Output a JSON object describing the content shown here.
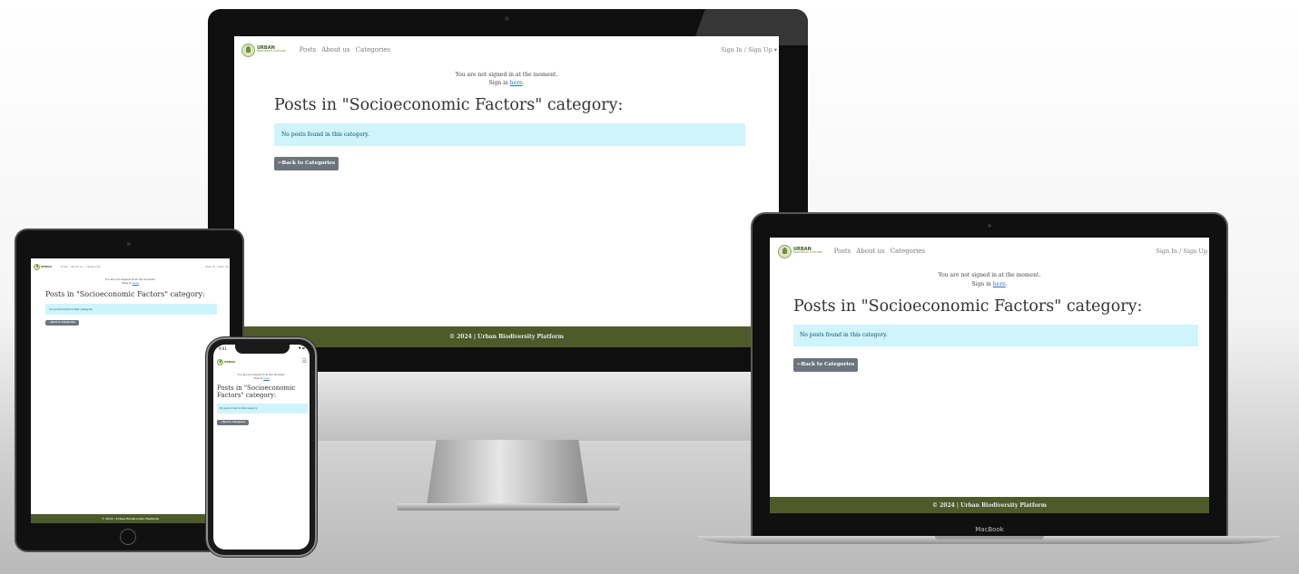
{
  "site": {
    "logo_title": "URBAN",
    "logo_sub": "BIODIVERSITY PLATFORM",
    "nav": {
      "posts": "Posts",
      "about": "About us",
      "categories": "Categories"
    },
    "signin_menu": "Sign In / Sign Up",
    "signin_caret": "▾",
    "notice_line1": "You are not signed in at the moment.",
    "notice_line2_prefix": "Sign in ",
    "notice_link": "here",
    "notice_line2_suffix": ".",
    "page_title": "Posts in \"Socioeconomic Factors\" category:",
    "alert": "No posts found in this category.",
    "back_button": "←Back to Categories",
    "footer": "© 2024 | Urban Biodiversity Platform"
  },
  "devices": {
    "macbook_label": "MacBook",
    "phone_time": "9:41",
    "phone_status_icons": "▼ ▬",
    "hamburger": "☰",
    "apple_logo": ""
  },
  "colors": {
    "footer_bg": "#4e5a2a",
    "alert_bg": "#cff4fc",
    "button_bg": "#6c757d",
    "link": "#2a6fd6"
  }
}
